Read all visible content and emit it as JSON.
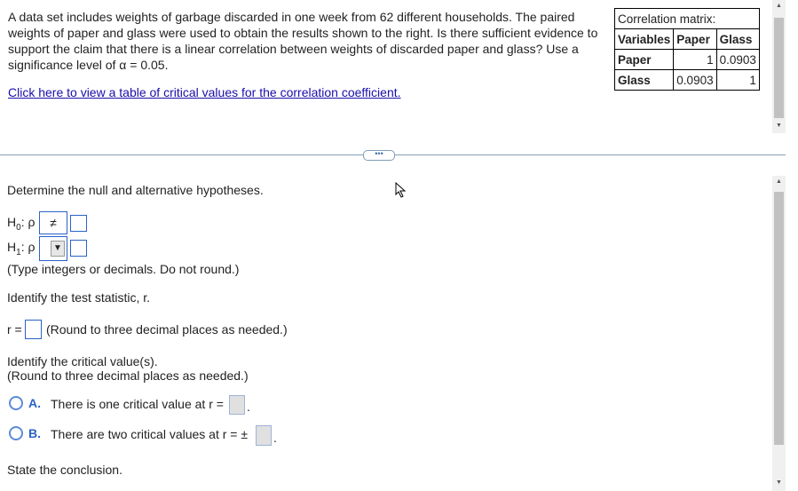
{
  "question": {
    "text": "A data set includes weights of garbage discarded in one week from 62 different households. The paired weights of paper and glass were used to obtain the results shown to the right. Is there sufficient evidence to support the claim that there is a linear correlation between weights of discarded paper and glass? Use a significance level of α = 0.05.",
    "link": "Click here to view a table of critical values for the correlation coefficient."
  },
  "matrix": {
    "title": "Correlation matrix:",
    "headers": [
      "Variables",
      "Paper",
      "Glass"
    ],
    "rows": [
      [
        "Paper",
        "1",
        "0.0903"
      ],
      [
        "Glass",
        "0.0903",
        "1"
      ]
    ]
  },
  "divider_handle": "•••",
  "part": {
    "hyp_prompt": "Determine the null and alternative hypotheses.",
    "h0_label": "H",
    "h0_sub": "0",
    "h1_label": "H",
    "h1_sub": "1",
    "rho": ": ρ",
    "h0_operator": "≠",
    "h1_operator_icon": "▼",
    "hyp_note": "(Type integers or decimals. Do not round.)",
    "stat_prompt": "Identify the test statistic, r.",
    "r_label": "r =",
    "r_note": "(Round to three decimal places as needed.)",
    "crit_prompt": "Identify the critical value(s).",
    "crit_note": "(Round to three decimal places as needed.)",
    "optA_letter": "A.",
    "optA_text": "There is one critical value at r =",
    "optB_letter": "B.",
    "optB_text": "There are two critical values at r = ±",
    "period": ".",
    "conclusion_prompt": "State the conclusion."
  }
}
